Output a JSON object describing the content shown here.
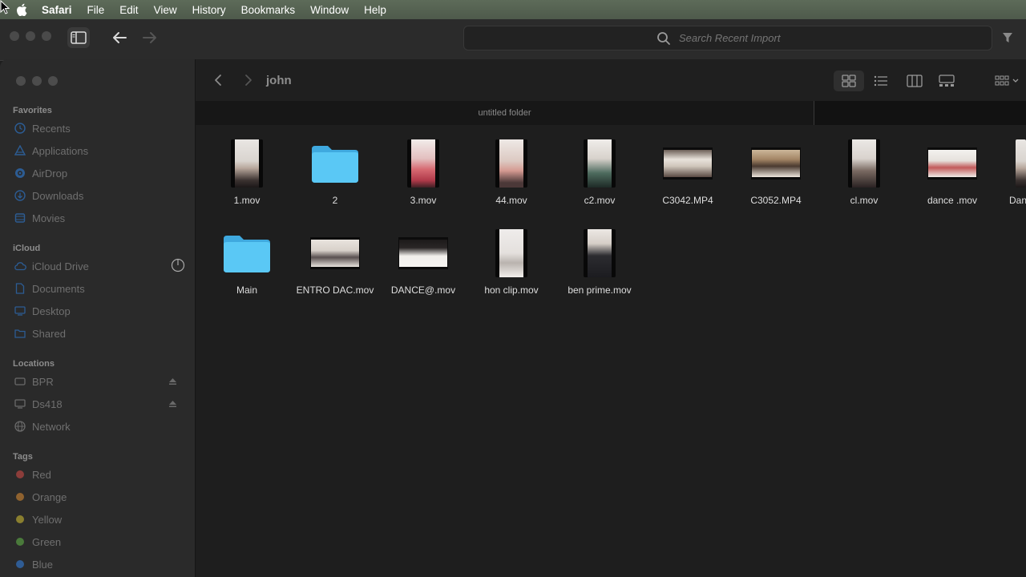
{
  "menubar": {
    "app": "Safari",
    "items": [
      "File",
      "Edit",
      "View",
      "History",
      "Bookmarks",
      "Window",
      "Help"
    ]
  },
  "background_window": {
    "search_placeholder": "Search Recent Import"
  },
  "finder": {
    "breadcrumb": "john",
    "tab_title": "untitled folder",
    "sidebar": {
      "favorites_header": "Favorites",
      "favorites": [
        "Recents",
        "Applications",
        "AirDrop",
        "Downloads",
        "Movies"
      ],
      "icloud_header": "iCloud",
      "icloud": [
        "iCloud Drive",
        "Documents",
        "Desktop",
        "Shared"
      ],
      "locations_header": "Locations",
      "locations": [
        "BPR",
        "Ds418",
        "Network"
      ],
      "tags_header": "Tags",
      "tags": [
        {
          "name": "Red",
          "color": "#c2504b"
        },
        {
          "name": "Orange",
          "color": "#c6853c"
        },
        {
          "name": "Yellow",
          "color": "#c4b23c"
        },
        {
          "name": "Green",
          "color": "#62a84c"
        },
        {
          "name": "Blue",
          "color": "#3f7fd0"
        }
      ]
    },
    "files_row1": [
      {
        "name": "1.mov",
        "kind": "portrait"
      },
      {
        "name": "2",
        "kind": "folder"
      },
      {
        "name": "3.mov",
        "kind": "portrait"
      },
      {
        "name": "44.mov",
        "kind": "portrait"
      },
      {
        "name": "c2.mov",
        "kind": "portrait"
      },
      {
        "name": "C3042.MP4",
        "kind": "landscape"
      },
      {
        "name": "C3052.MP4",
        "kind": "landscape"
      },
      {
        "name": "cl.mov",
        "kind": "portrait"
      },
      {
        "name": "dance .mov",
        "kind": "landscape"
      },
      {
        "name": "Dan",
        "kind": "portrait"
      }
    ],
    "files_row2": [
      {
        "name": "Main",
        "kind": "folder"
      },
      {
        "name": "ENTRO DAC.mov",
        "kind": "landscape"
      },
      {
        "name": "DANCE@.mov",
        "kind": "landscape"
      },
      {
        "name": "hon clip.mov",
        "kind": "portrait"
      },
      {
        "name": "ben prime.mov",
        "kind": "portrait"
      }
    ],
    "colors": {
      "folder": "#5ac8f5",
      "accent": "#3f7fd0"
    }
  }
}
